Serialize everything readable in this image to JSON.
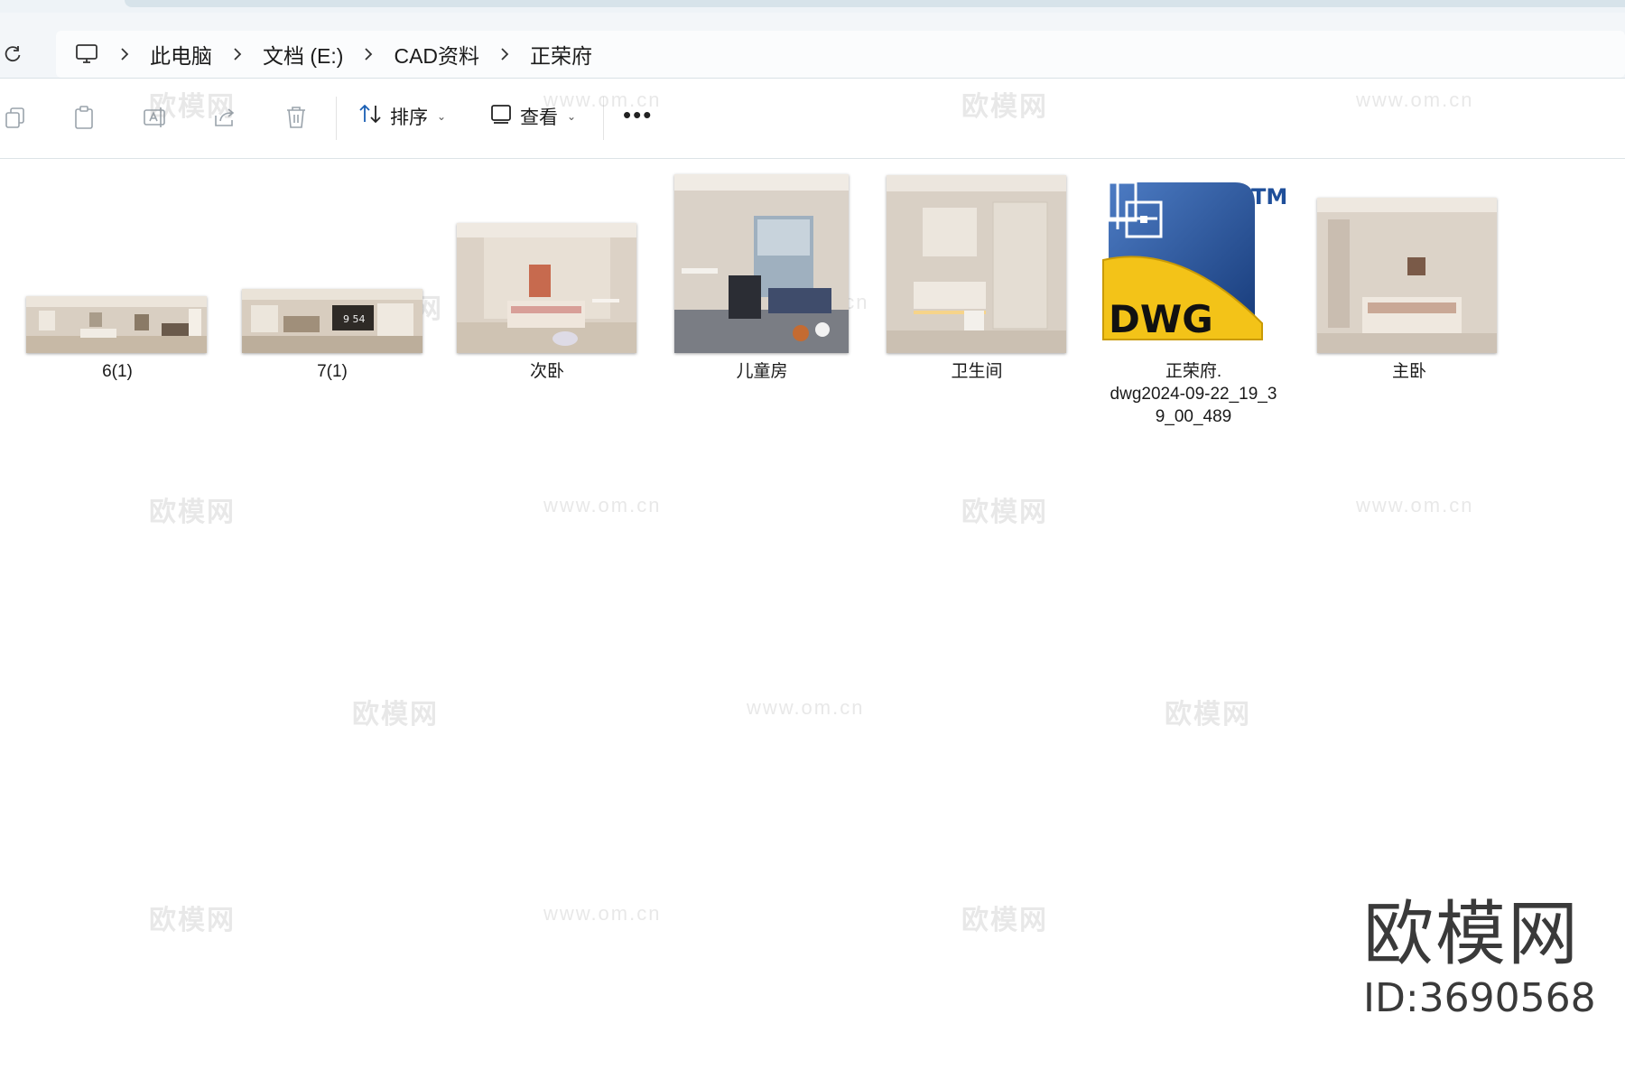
{
  "address_bar": {
    "breadcrumbs": [
      "此电脑",
      "文档 (E:)",
      "CAD资料",
      "正荣府"
    ]
  },
  "toolbar": {
    "sort_label": "排序",
    "view_label": "查看",
    "more_label": "•••"
  },
  "files": [
    {
      "name": "6(1)",
      "type": "image"
    },
    {
      "name": "7(1)",
      "type": "image"
    },
    {
      "name": "次卧",
      "type": "image"
    },
    {
      "name": "儿童房",
      "type": "image"
    },
    {
      "name": "卫生间",
      "type": "image"
    },
    {
      "name": "正荣府.\ndwg2024-09-22_19_3\n9_00_489",
      "type": "dwg",
      "icon_text": "DWG",
      "icon_tm": "TM"
    },
    {
      "name": "主卧",
      "type": "image"
    }
  ],
  "watermarks": {
    "cn": "欧模网",
    "url": "www.om.cn"
  },
  "brand": {
    "name": "欧模网",
    "id": "ID:3690568"
  },
  "colors": {
    "dwg_blue": "#1f4f9a",
    "dwg_yellow": "#f3c318"
  }
}
